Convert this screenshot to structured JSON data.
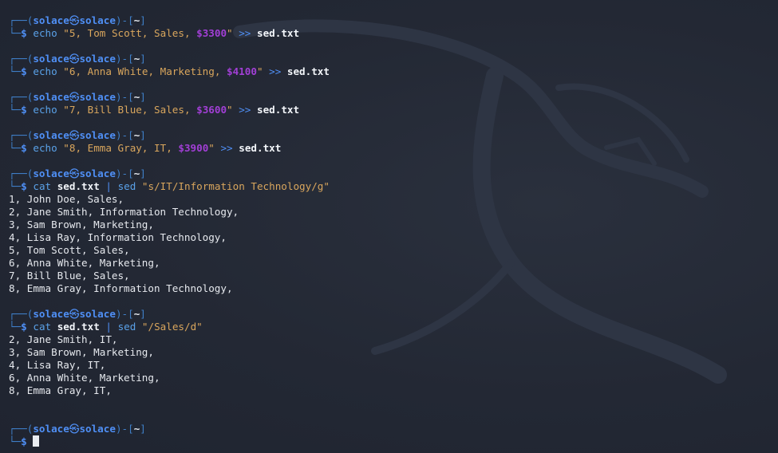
{
  "theme": {
    "background": "#232834",
    "prompt_blue": "#4f8ff5",
    "string_color": "#d9a65d",
    "money_color": "#a23fd6"
  },
  "prompt": {
    "box_top_start": "┌──(",
    "user": "solace",
    "skull": "㉿",
    "host": "solace",
    "box_mid": ")-[",
    "dir": "~",
    "box_end": "]",
    "box_bottom": "└─",
    "dollar": "$"
  },
  "commands": [
    {
      "cmd": "echo",
      "string_pre": "\"5, Tom Scott, Sales, ",
      "money": "$3300",
      "string_post": "\"",
      "op": ">>",
      "file": "sed.txt"
    },
    {
      "cmd": "echo",
      "string_pre": "\"6, Anna White, Marketing, ",
      "money": "$4100",
      "string_post": "\"",
      "op": ">>",
      "file": "sed.txt"
    },
    {
      "cmd": "echo",
      "string_pre": "\"7, Bill Blue, Sales, ",
      "money": "$3600",
      "string_post": "\"",
      "op": ">>",
      "file": "sed.txt"
    },
    {
      "cmd": "echo",
      "string_pre": "\"8, Emma Gray, IT, ",
      "money": "$3900",
      "string_post": "\"",
      "op": ">>",
      "file": "sed.txt"
    }
  ],
  "cat1": {
    "cmd": "cat",
    "file": "sed.txt",
    "pipe": "|",
    "cmd2": "sed",
    "arg": "\"s/IT/Information Technology/g\"",
    "output": [
      "1, John Doe, Sales,",
      "2, Jane Smith, Information Technology,",
      "3, Sam Brown, Marketing,",
      "4, Lisa Ray, Information Technology,",
      "5, Tom Scott, Sales,",
      "6, Anna White, Marketing,",
      "7, Bill Blue, Sales,",
      "8, Emma Gray, Information Technology,"
    ]
  },
  "cat2": {
    "cmd": "cat",
    "file": "sed.txt",
    "pipe": "|",
    "cmd2": "sed",
    "arg": "\"/Sales/d\"",
    "output": [
      "2, Jane Smith, IT,",
      "3, Sam Brown, Marketing,",
      "4, Lisa Ray, IT,",
      "6, Anna White, Marketing,",
      "8, Emma Gray, IT,"
    ]
  }
}
